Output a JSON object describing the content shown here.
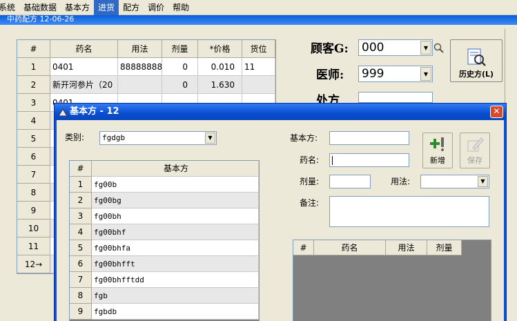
{
  "menu": {
    "items": [
      "系统",
      "基础数据",
      "基本方",
      "进货",
      "配方",
      "调价",
      "帮助"
    ],
    "active_index": 3
  },
  "background_window": {
    "title": "中药配方  12-06-26",
    "grid": {
      "headers": [
        "#",
        "药名",
        "用法",
        "剂量",
        "*价格",
        "货位"
      ],
      "rows": [
        {
          "num": "1",
          "name": "0401",
          "usage": "888888888",
          "dose": "0",
          "price": "0.010",
          "loc": "11"
        },
        {
          "num": "2",
          "name": "新开河参片（20",
          "usage": "",
          "dose": "0",
          "price": "1.630",
          "loc": ""
        },
        {
          "num": "3",
          "name": "0401",
          "usage": "",
          "dose": "",
          "price": "",
          "loc": ""
        },
        {
          "num": "4",
          "name": "",
          "usage": "",
          "dose": "",
          "price": "",
          "loc": ""
        },
        {
          "num": "5",
          "name": "",
          "usage": "",
          "dose": "",
          "price": "",
          "loc": ""
        },
        {
          "num": "6",
          "name": "",
          "usage": "",
          "dose": "",
          "price": "",
          "loc": ""
        },
        {
          "num": "7",
          "name": "",
          "usage": "",
          "dose": "",
          "price": "",
          "loc": ""
        },
        {
          "num": "8",
          "name": "",
          "usage": "",
          "dose": "",
          "price": "",
          "loc": ""
        },
        {
          "num": "9",
          "name": "",
          "usage": "",
          "dose": "",
          "price": "",
          "loc": ""
        },
        {
          "num": "10",
          "name": "",
          "usage": "",
          "dose": "",
          "price": "",
          "loc": ""
        },
        {
          "num": "11",
          "name": "",
          "usage": "",
          "dose": "",
          "price": "",
          "loc": ""
        },
        {
          "num": "12→",
          "name": "",
          "usage": "",
          "dose": "",
          "price": "",
          "loc": ""
        }
      ]
    },
    "customer_label": "顾客G:",
    "customer_value": "000",
    "doctor_label": "医师:",
    "doctor_value": "999",
    "prescription_label": "处方",
    "history_button": "历史方(L)"
  },
  "dialog": {
    "title": "基本方 - 12",
    "category_label": "类别:",
    "category_value": "fgdgb",
    "grid_headers": [
      "#",
      "基本方"
    ],
    "grid_rows": [
      {
        "num": "1",
        "value": "fg00b"
      },
      {
        "num": "2",
        "value": "fg00bg"
      },
      {
        "num": "3",
        "value": "fg00bh"
      },
      {
        "num": "4",
        "value": "fg00bhf"
      },
      {
        "num": "5",
        "value": "fg00bhfa"
      },
      {
        "num": "6",
        "value": "fg00bhfft"
      },
      {
        "num": "7",
        "value": "fg00bhfftdd"
      },
      {
        "num": "8",
        "value": "fgb"
      },
      {
        "num": "9",
        "value": "fgbdb"
      }
    ],
    "basic_label": "基本方:",
    "drug_label": "药名:",
    "dose_label": "剂量:",
    "usage_label": "用法:",
    "note_label": "备注:",
    "new_button": "新增",
    "save_button": "保存",
    "detail_headers": [
      "#",
      "药名",
      "用法",
      "剂量"
    ]
  }
}
